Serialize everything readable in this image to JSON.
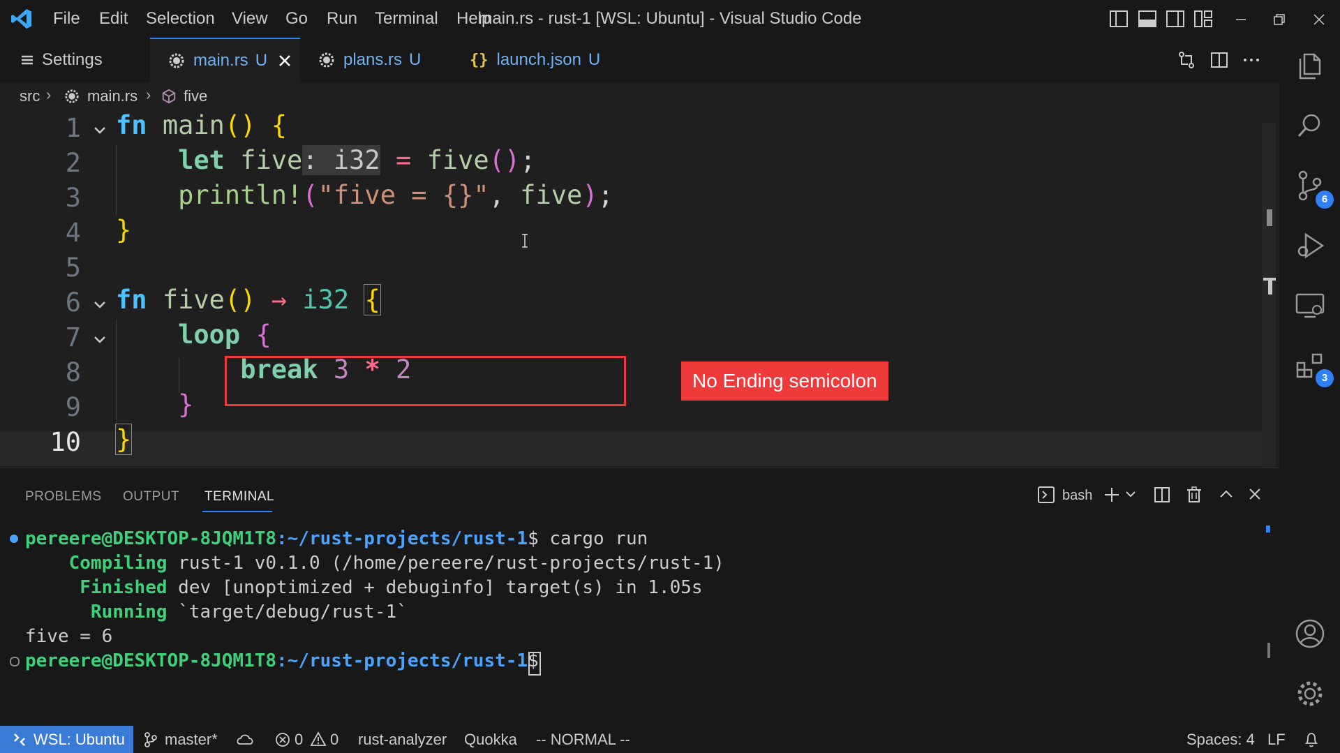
{
  "window": {
    "title": "main.rs - rust-1 [WSL: Ubuntu] - Visual Studio Code",
    "menu": [
      "File",
      "Edit",
      "Selection",
      "View",
      "Go",
      "Run",
      "Terminal",
      "Help"
    ]
  },
  "tabs": [
    {
      "label": "Settings",
      "status": "",
      "icon": "settings-lines-icon"
    },
    {
      "label": "main.rs",
      "status": "U",
      "icon": "rust-file-icon",
      "active": true
    },
    {
      "label": "plans.rs",
      "status": "U",
      "icon": "rust-file-icon"
    },
    {
      "label": "launch.json",
      "status": "U",
      "icon": "json-braces-icon"
    }
  ],
  "breadcrumb": {
    "folder": "src",
    "file": "main.rs",
    "symbol": "five"
  },
  "editor": {
    "line_numbers": [
      "1",
      "2",
      "3",
      "4",
      "5",
      "6",
      "7",
      "8",
      "9",
      "10"
    ],
    "active_line": "10",
    "inlay_hint": ": i32",
    "code": {
      "fn": "fn",
      "main": "main",
      "let": "let",
      "five": "five",
      "i32": "i32",
      "println": "println!",
      "format_str": "\"five = {}\"",
      "arrow": "→",
      "loop": "loop",
      "break": "break",
      "three": "3",
      "times": "*",
      "two": "2"
    }
  },
  "annotation": {
    "label": "No Ending semicolon",
    "color": "#ee3a3a"
  },
  "panel": {
    "tabs": [
      "PROBLEMS",
      "OUTPUT",
      "TERMINAL"
    ],
    "active_tab": "TERMINAL",
    "shell": "bash",
    "terminal": {
      "prompt_user": "pereere@DESKTOP-8JQM1T8",
      "prompt_path": ":~/rust-projects/rust-1",
      "prompt_end": "$ ",
      "command": "cargo run",
      "compiling_label": "Compiling",
      "compiling_text": " rust-1 v0.1.0 (/home/pereere/rust-projects/rust-1)",
      "finished_label": "Finished",
      "finished_text": " dev [unoptimized + debuginfo] target(s) in 1.05s",
      "running_label": "Running",
      "running_text": " `target/debug/rust-1`",
      "output": "five = 6"
    }
  },
  "activity_badges": {
    "source_control": "6",
    "extensions": "3"
  },
  "statusbar": {
    "remote": "WSL: Ubuntu",
    "branch": "master*",
    "errors": "0",
    "warnings": "0",
    "analyzer": "rust-analyzer",
    "quokka": "Quokka",
    "mode": "-- NORMAL --",
    "spaces": "Spaces: 4",
    "eol": "LF"
  },
  "colors": {
    "remote_bg": "#3b7bd8",
    "accent": "#2f81f7",
    "annotation": "#ee3a3a"
  }
}
